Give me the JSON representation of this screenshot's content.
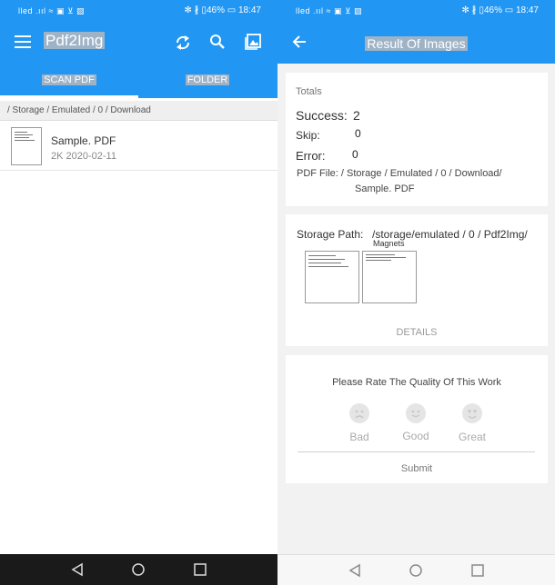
{
  "status_bar": {
    "left_text": "lled .ııl ≈ ▣ ⊻ ▨",
    "right_text": "✻ ∦ ▯46% ▭ 18:47"
  },
  "left": {
    "app_title": "Pdf2Img",
    "tabs": [
      {
        "label": "SCAN PDF"
      },
      {
        "label": "FOLDER"
      }
    ],
    "path": "/ Storage / Emulated / 0 / Download",
    "files": [
      {
        "name": "Sample. PDF",
        "meta": "2K 2020-02-11"
      }
    ]
  },
  "right": {
    "title": "Result Of Images",
    "totals": {
      "heading": "Totals",
      "success_label": "Success:",
      "success_value": "2",
      "skip_label": "Skip:",
      "skip_value": "0",
      "error_label": "Error:",
      "error_value": "0",
      "pdf_file_line1": "PDF File: / Storage / Emulated / 0 / Download/",
      "pdf_file_line2": "Sample. PDF"
    },
    "storage": {
      "label": "Storage Path:",
      "value": "/storage/emulated / 0 / Pdf2Img/",
      "subfolder": "Magnets",
      "details_label": "DETAILS"
    },
    "rating": {
      "prompt": "Please Rate The Quality Of This Work",
      "options": [
        {
          "label": "Bad",
          "icon": "sad-face-icon"
        },
        {
          "label": "Good",
          "icon": "neutral-face-icon"
        },
        {
          "label": "Great",
          "icon": "heart-eyes-face-icon"
        }
      ],
      "submit_label": "Submit"
    }
  },
  "colors": {
    "primary": "#2196f3",
    "background": "#f2f2f2",
    "nav_dark": "#1a1a1a"
  }
}
